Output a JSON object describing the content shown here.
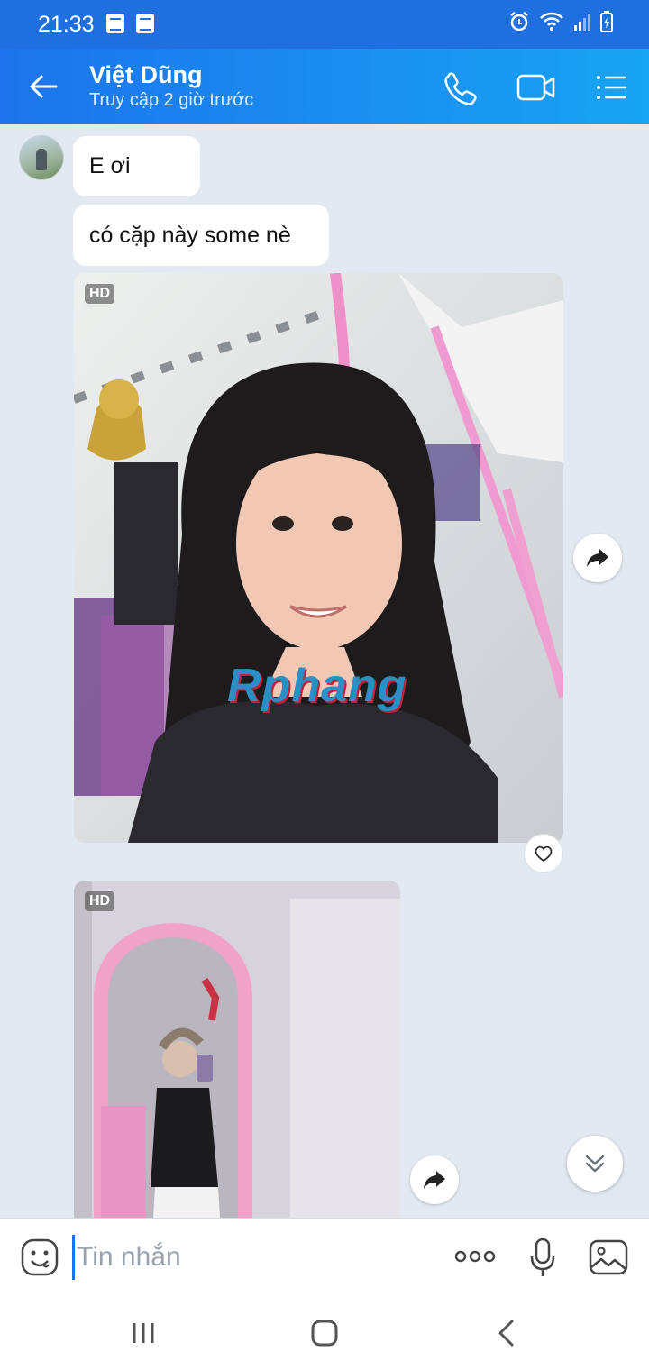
{
  "status_bar": {
    "time": "21:33"
  },
  "header": {
    "contact_name": "Việt Dũng",
    "last_seen": "Truy cập 2 giờ trước"
  },
  "messages": {
    "text_1": "E ơi",
    "text_2": "có cặp này some nè",
    "photo_badge": "HD",
    "watermark": "Rphang"
  },
  "composer": {
    "placeholder": "Tin nhắn"
  },
  "colors": {
    "header_start": "#1d74ec",
    "header_end": "#17a4f3",
    "chat_background": "#e2e9f1",
    "accent": "#1a73e8"
  },
  "icons": [
    "arrow-left-icon",
    "phone-icon",
    "video-call-icon",
    "menu-list-icon",
    "share-forward-icon",
    "heart-icon",
    "chevron-double-down-icon",
    "emoji-icon",
    "more-dots-icon",
    "microphone-icon",
    "image-icon",
    "recents-nav-icon",
    "home-nav-icon",
    "back-nav-icon"
  ]
}
